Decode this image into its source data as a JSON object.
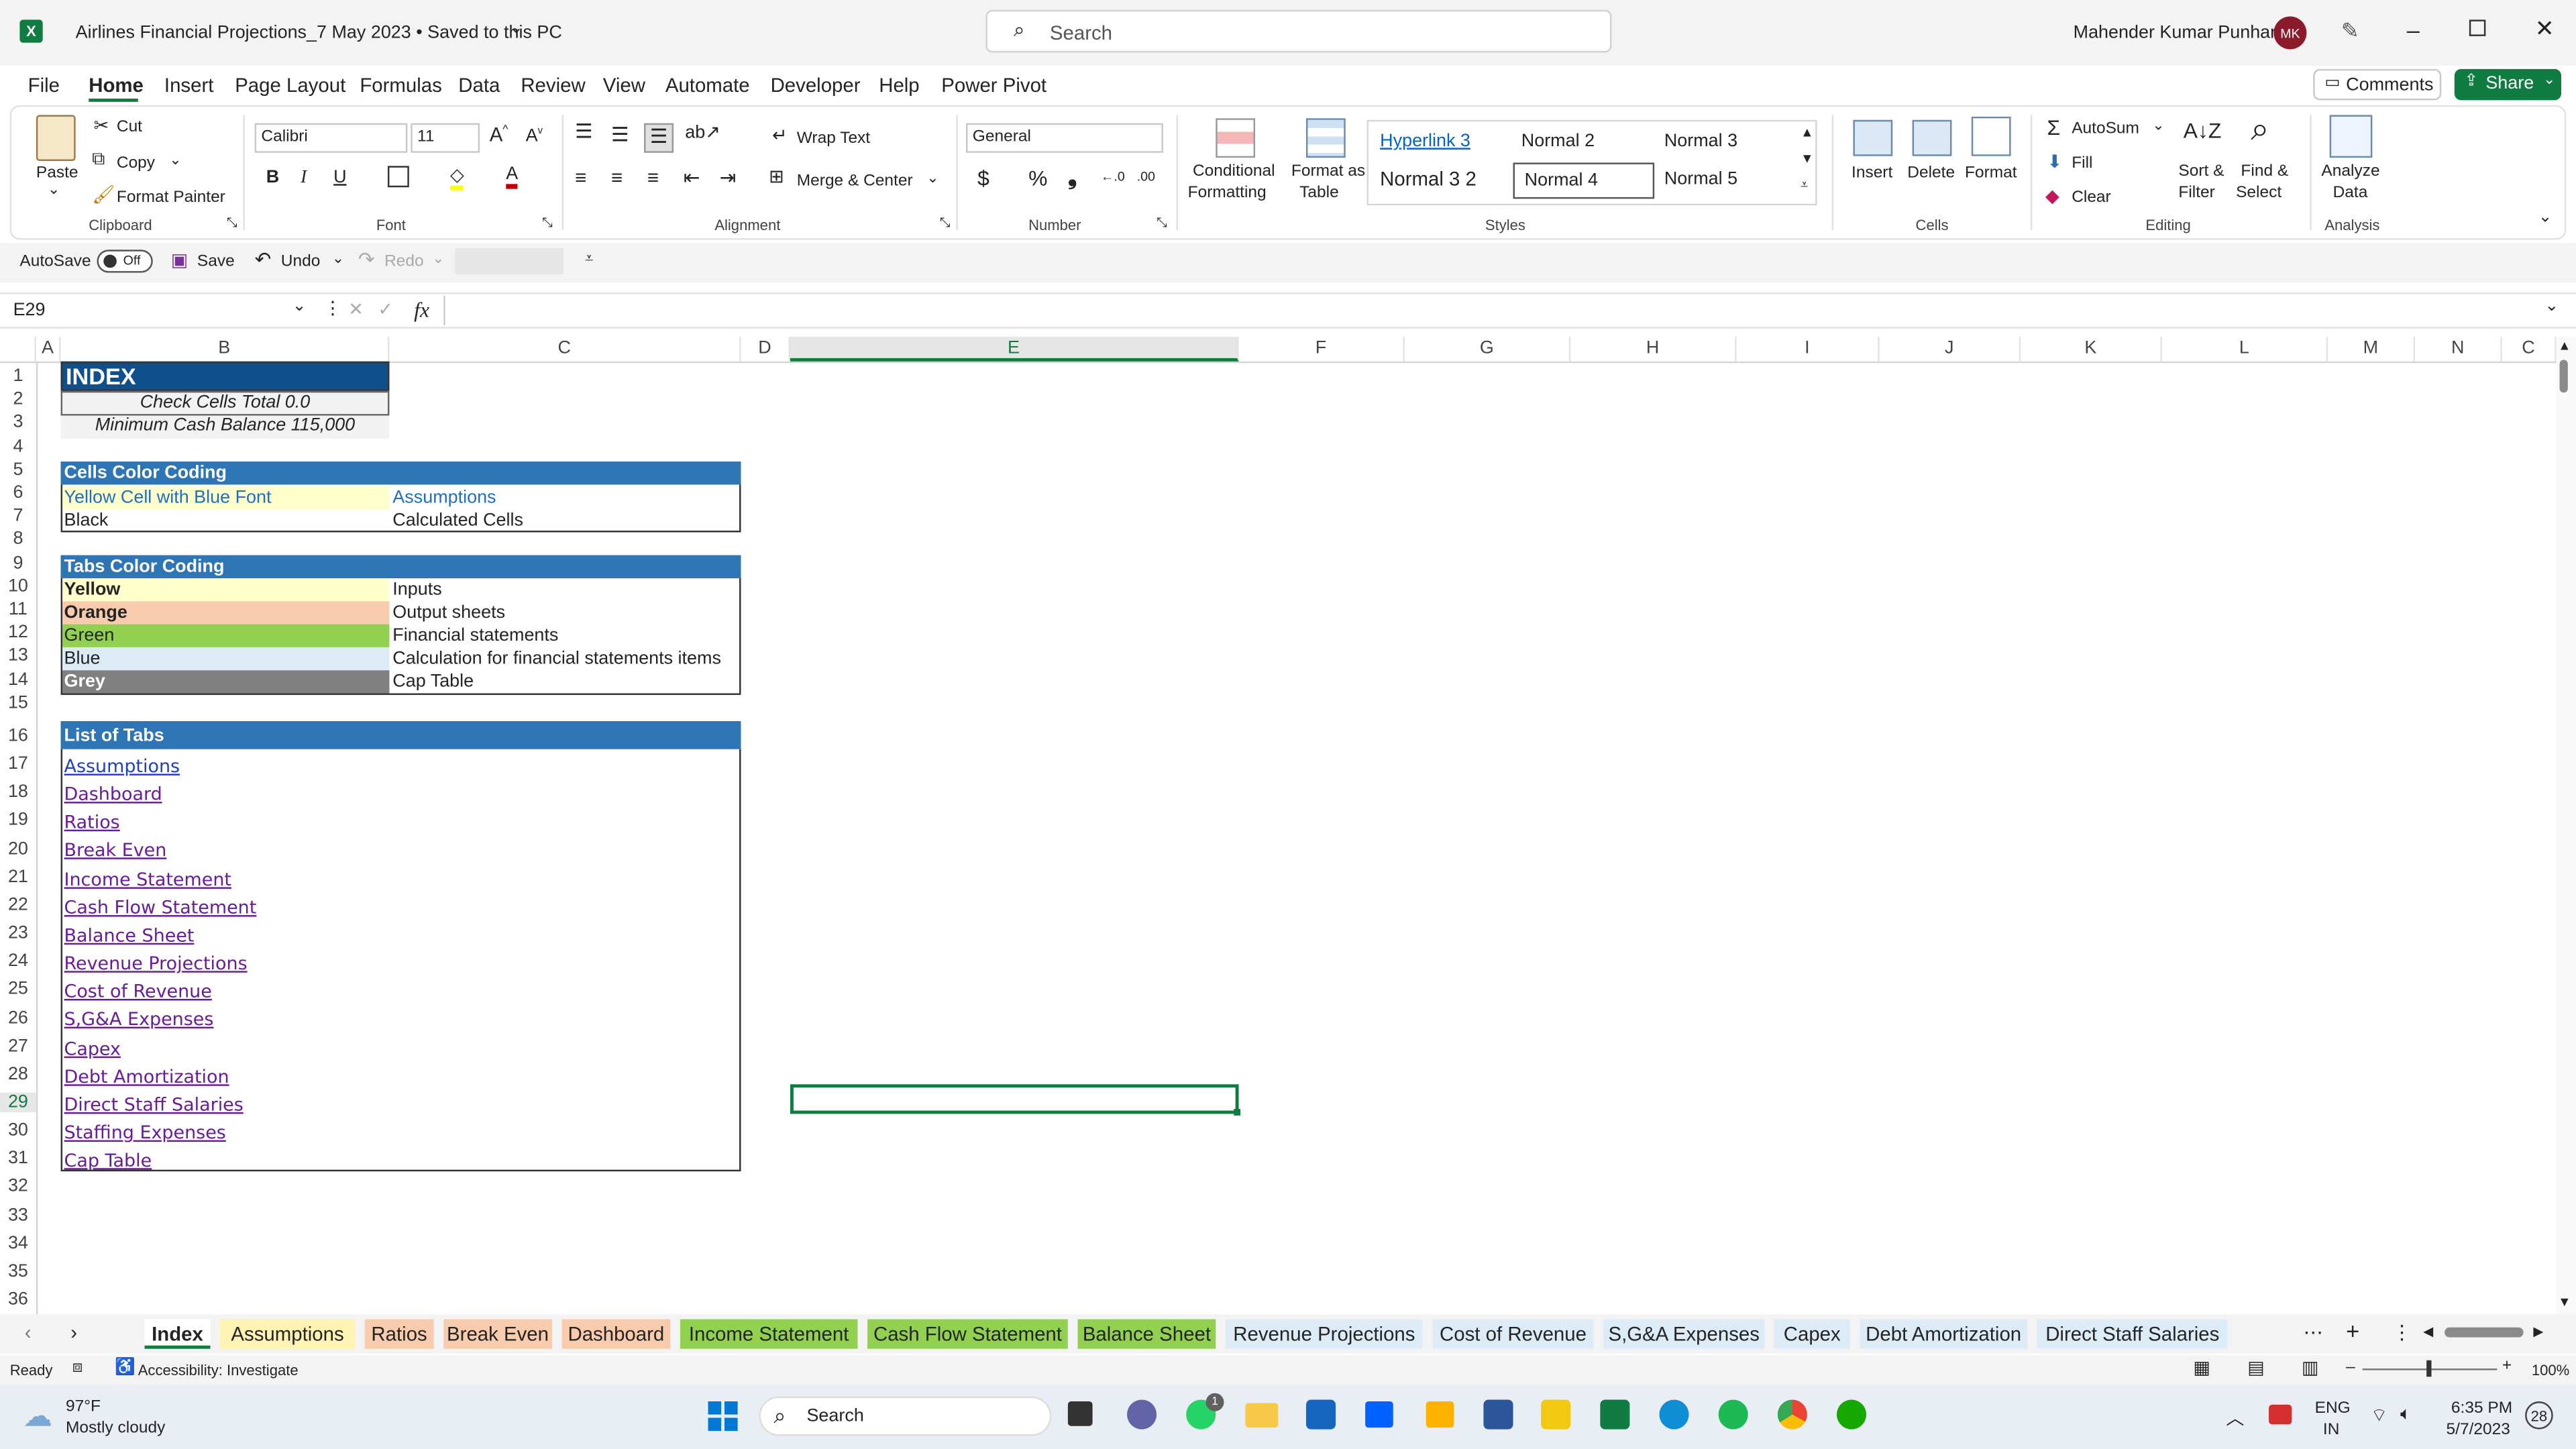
{
  "window": {
    "title": "Airlines Financial Projections_7 May 2023 • Saved to this PC",
    "search_placeholder": "Search",
    "user_name": "Mahender Kumar Punhani",
    "user_initials": "MK"
  },
  "menu": [
    "File",
    "Home",
    "Insert",
    "Page Layout",
    "Formulas",
    "Data",
    "Review",
    "View",
    "Automate",
    "Developer",
    "Help",
    "Power Pivot"
  ],
  "buttons": {
    "comments": "Comments",
    "share": "Share"
  },
  "ribbon": {
    "paste": "Paste",
    "cut": "Cut",
    "copy": "Copy",
    "format_painter": "Format Painter",
    "clipboard": "Clipboard",
    "font_name": "Calibri",
    "font_size": "11",
    "font_group": "Font",
    "wrap_text": "Wrap Text",
    "merge_center": "Merge & Center",
    "alignment": "Alignment",
    "number_format": "General",
    "number": "Number",
    "conditional_1": "Conditional",
    "conditional_2": "Formatting",
    "format_table_1": "Format as",
    "format_table_2": "Table",
    "styles": [
      "Hyperlink 3",
      "Normal 2",
      "Normal 3",
      "Normal 3 2",
      "Normal 4",
      "Normal 5"
    ],
    "styles_group": "Styles",
    "insert": "Insert",
    "delete": "Delete",
    "format": "Format",
    "cells": "Cells",
    "autosum": "AutoSum",
    "fill": "Fill",
    "clear": "Clear",
    "sort_1": "Sort &",
    "sort_2": "Filter",
    "find_1": "Find &",
    "find_2": "Select",
    "editing": "Editing",
    "analyze_1": "Analyze",
    "analyze_2": "Data",
    "analysis": "Analysis"
  },
  "qat": {
    "autosave": "AutoSave",
    "toggle": "Off",
    "save": "Save",
    "undo": "Undo",
    "redo": "Redo"
  },
  "formula_bar": {
    "name_box": "E29",
    "fx": "fx",
    "formula": ""
  },
  "columns": [
    "A",
    "B",
    "C",
    "D",
    "E",
    "F",
    "G",
    "H",
    "I",
    "J",
    "K",
    "L",
    "M",
    "N",
    "C"
  ],
  "rows": [
    "1",
    "2",
    "3",
    "4",
    "5",
    "6",
    "7",
    "8",
    "9",
    "10",
    "11",
    "12",
    "13",
    "14",
    "15",
    "16",
    "17",
    "18",
    "19",
    "20",
    "21",
    "22",
    "23",
    "24",
    "25",
    "26",
    "27",
    "28",
    "29",
    "30",
    "31",
    "32",
    "33",
    "34",
    "35",
    "36"
  ],
  "sheet": {
    "index_title": "INDEX",
    "check_cells": "Check Cells Total 0.0",
    "min_cash": "Minimum Cash Balance 115,000",
    "cells_color_coding": "Cells Color Coding",
    "yellow_cell": "Yellow Cell with Blue Font",
    "assumptions": "Assumptions",
    "black": "Black",
    "calculated": "Calculated Cells",
    "tabs_color_coding": "Tabs Color Coding",
    "tab_rows": [
      {
        "color": "Yellow",
        "meaning": "Inputs"
      },
      {
        "color": "Orange",
        "meaning": "Output sheets"
      },
      {
        "color": "Green",
        "meaning": "Financial statements"
      },
      {
        "color": "Blue",
        "meaning": "Calculation for financial statements items"
      },
      {
        "color": "Grey",
        "meaning": "Cap Table"
      }
    ],
    "list_of_tabs": "List of Tabs",
    "tab_links": [
      "Assumptions",
      "Dashboard",
      "Ratios ",
      "Break Even",
      "Income Statement",
      "Cash Flow Statement",
      "Balance Sheet",
      "Revenue Projections",
      "Cost of Revenue",
      "S,G&A Expenses",
      "Capex ",
      "Debt Amortization",
      "Direct Staff Salaries",
      "Staffing Expenses",
      "Cap Table "
    ]
  },
  "sheet_tabs": [
    {
      "label": "Index",
      "color": "#ffffff"
    },
    {
      "label": "Assumptions",
      "color": "#fff2b3"
    },
    {
      "label": "Ratios",
      "color": "#f8cbad"
    },
    {
      "label": "Break Even",
      "color": "#f8cbad"
    },
    {
      "label": "Dashboard",
      "color": "#f8cbad"
    },
    {
      "label": "Income Statement",
      "color": "#92d050"
    },
    {
      "label": "Cash Flow Statement",
      "color": "#92d050"
    },
    {
      "label": "Balance Sheet",
      "color": "#92d050"
    },
    {
      "label": "Revenue Projections",
      "color": "#ddebf7"
    },
    {
      "label": "Cost of Revenue",
      "color": "#ddebf7"
    },
    {
      "label": "S,G&A Expenses",
      "color": "#ddebf7"
    },
    {
      "label": "Capex",
      "color": "#ddebf7"
    },
    {
      "label": "Debt Amortization",
      "color": "#ddebf7"
    },
    {
      "label": "Direct Staff Salaries",
      "color": "#ddebf7"
    }
  ],
  "status": {
    "ready": "Ready",
    "accessibility": "Accessibility: Investigate",
    "zoom": "100%"
  },
  "taskbar": {
    "temp": "97°F",
    "weather": "Mostly cloudy",
    "search": "Search",
    "lang_1": "ENG",
    "lang_2": "IN",
    "time": "6:35 PM",
    "date": "5/7/2023",
    "badge": "28",
    "whatsapp_badge": "1"
  }
}
